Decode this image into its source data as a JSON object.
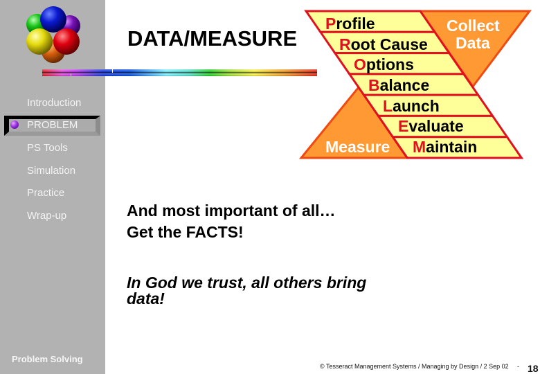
{
  "sidebar": {
    "logo_icon": "colored-spheres-cluster",
    "nav_items": [
      {
        "label": "Introduction",
        "active": false
      },
      {
        "label": "PROBLEM",
        "active": true,
        "bullet_icon": "purple-sphere"
      },
      {
        "label": "PS Tools",
        "active": false
      },
      {
        "label": "Simulation",
        "active": false
      },
      {
        "label": "Practice",
        "active": false
      },
      {
        "label": "Wrap-up",
        "active": false
      }
    ],
    "section_label": "Problem Solving"
  },
  "slide": {
    "title": "DATA/MEASURE",
    "quote_primary": {
      "lines": [
        "And most important of all…",
        "Get the FACTS!"
      ]
    },
    "quote_secondary": {
      "lines": [
        "In God we trust, all others bring",
        "data!"
      ]
    }
  },
  "diagram": {
    "bands": [
      {
        "initial": "P",
        "rest": "rofile"
      },
      {
        "initial": "R",
        "rest": "oot Cause"
      },
      {
        "initial": "O",
        "rest": "ptions"
      },
      {
        "initial": "B",
        "rest": "alance"
      },
      {
        "initial": "L",
        "rest": "aunch"
      },
      {
        "initial": "E",
        "rest": "valuate"
      },
      {
        "initial": "M",
        "rest": "aintain"
      }
    ],
    "collect_label": [
      "Collect",
      "Data"
    ],
    "measure_label": "Measure",
    "colors": {
      "band_fill": "#ffff99",
      "band_stroke": "#e0101e",
      "triangle_fill": "#ff9933",
      "triangle_stroke": "#ee4a12",
      "initial_text": "#e0101e",
      "band_text": "#000000",
      "triangle_text": "#ffffff"
    }
  },
  "footer": {
    "copyright": "© Tesseract Management Systems / Managing by Design / 2 Sep 02",
    "separator": "-",
    "page_number": "18"
  }
}
